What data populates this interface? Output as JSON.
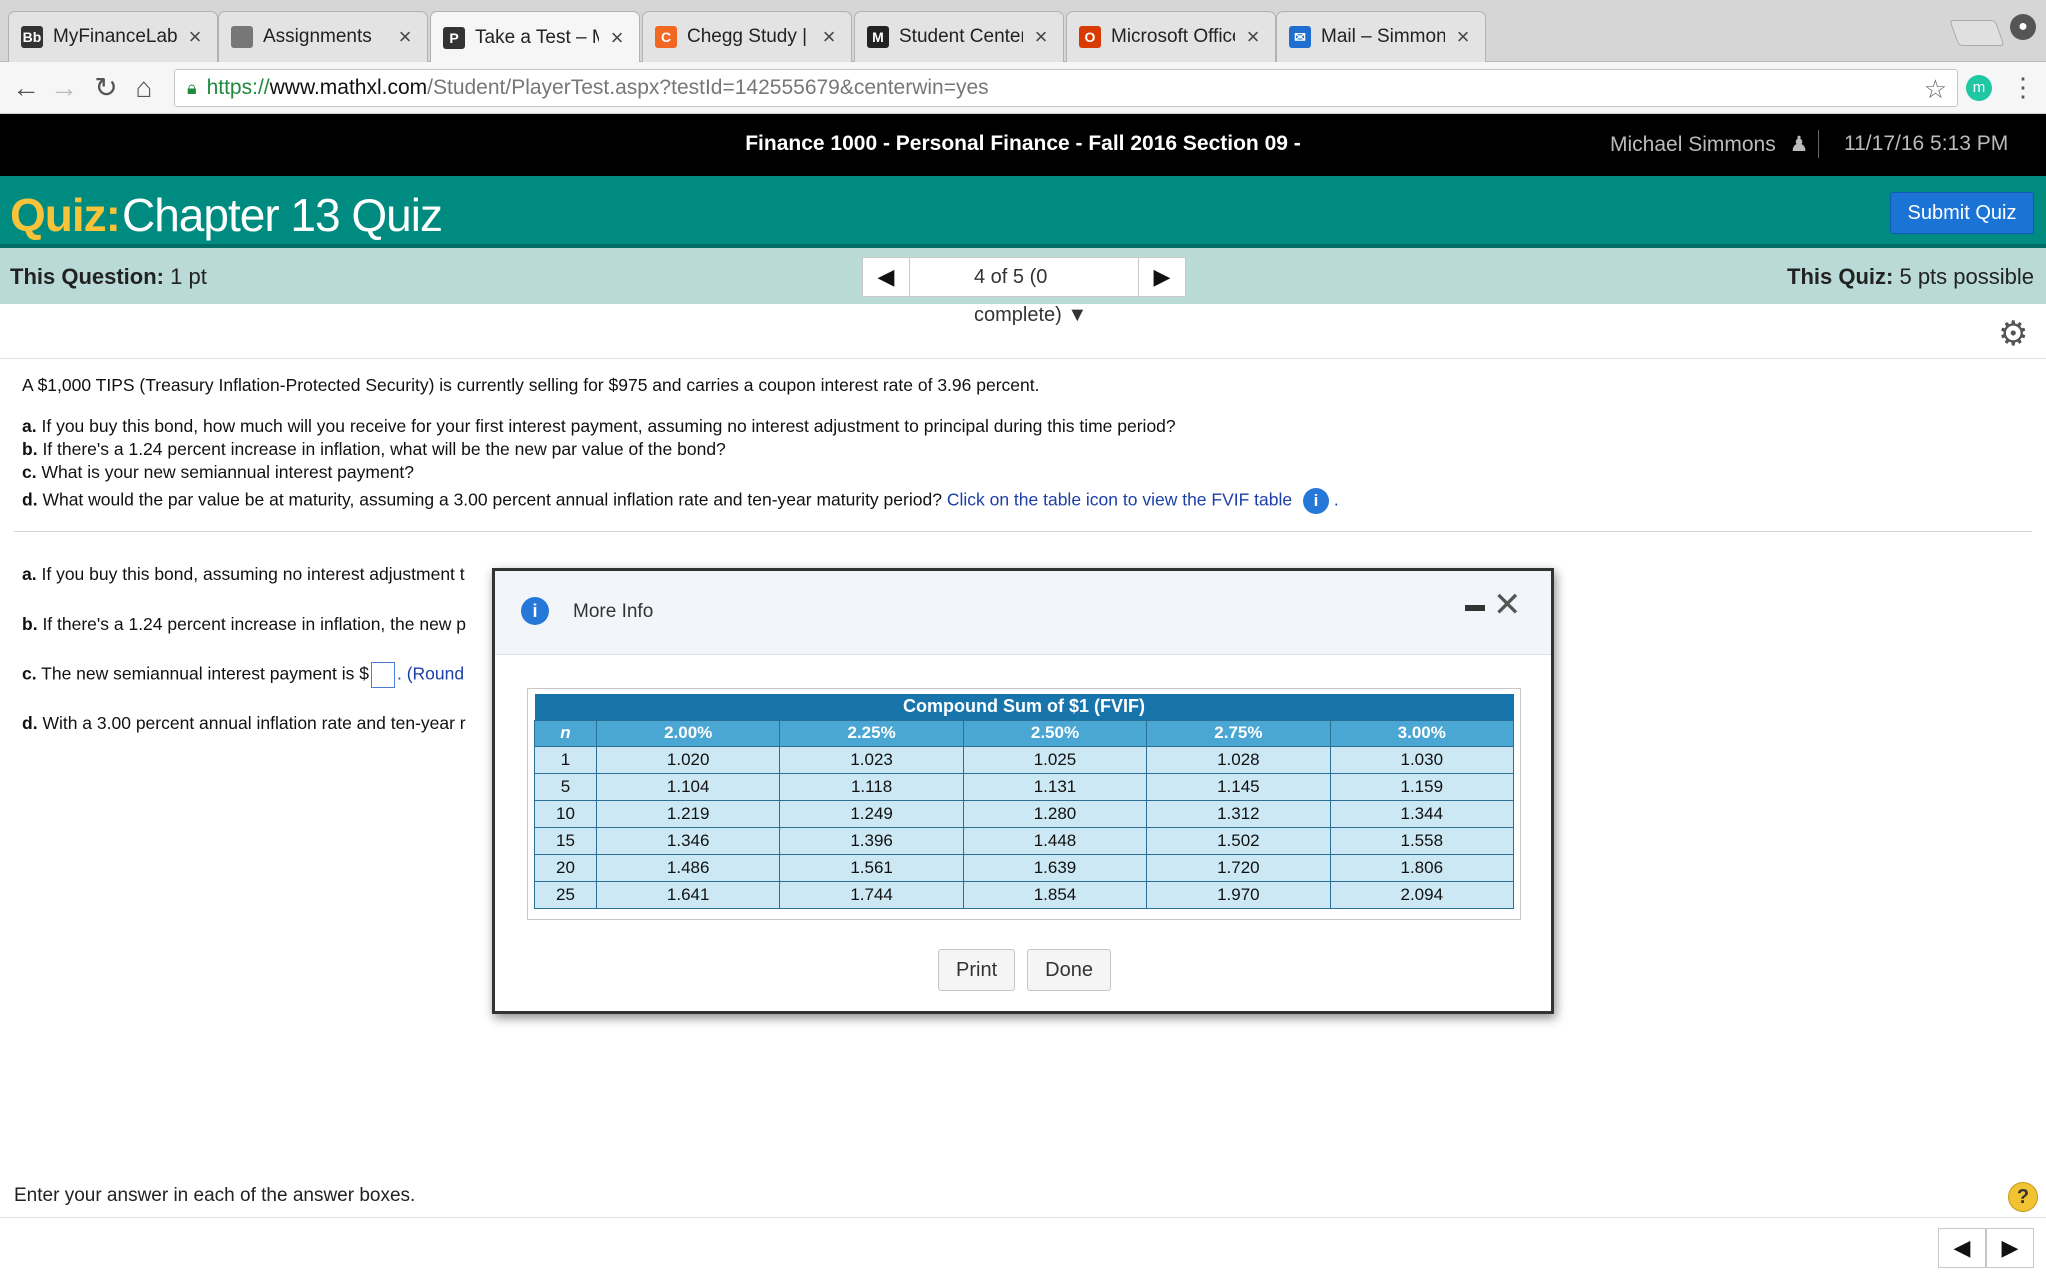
{
  "browser": {
    "tabs": [
      {
        "label": "MyFinanceLab – FINANC",
        "icon": "blackboard-icon",
        "favicon_text": "Bb",
        "favicon_color": "#333333"
      },
      {
        "label": "Assignments",
        "icon": "document-icon",
        "favicon_text": "",
        "favicon_color": "#777777"
      },
      {
        "label": "Take a Test – Michael Si",
        "icon": "pearson-icon",
        "favicon_text": "P",
        "favicon_color": "#333333"
      },
      {
        "label": "Chegg Study | Guided S",
        "icon": "chegg-icon",
        "favicon_text": "C",
        "favicon_color": "#f26722"
      },
      {
        "label": "Student Center",
        "icon": "mizzou-icon",
        "favicon_text": "M",
        "favicon_color": "#222222"
      },
      {
        "label": "Microsoft Office Home",
        "icon": "office-icon",
        "favicon_text": "O",
        "favicon_color": "#d83b01"
      },
      {
        "label": "Mail – Simmons, Michae",
        "icon": "mail-icon",
        "favicon_text": "✉",
        "favicon_color": "#1f6fd0"
      }
    ],
    "url_scheme": "https://",
    "url_host": "www.mathxl.com",
    "url_path": "/Student/PlayerTest.aspx?testId=142555679&centerwin=yes",
    "extension_letter": "m"
  },
  "header": {
    "course_title": "Finance 1000 - Personal Finance - Fall 2016 Section 09 -",
    "user_name": "Michael Simmons",
    "datetime": "11/17/16 5:13 PM"
  },
  "quiz": {
    "prefix": "Quiz:",
    "name": "Chapter 13 Quiz",
    "submit_label": "Submit Quiz",
    "this_question_label": "This Question:",
    "this_question_value": "1 pt",
    "this_quiz_label": "This Quiz:",
    "this_quiz_value": "5 pts possible",
    "pager_text": "4 of 5 (0 complete)"
  },
  "question": {
    "intro": "A $1,000 TIPS (Treasury Inflation-Protected Security) is currently selling for $975 and carries a coupon interest rate of 3.96 percent.",
    "a_label": "a.",
    "a_text": "If you buy this bond, how much will you receive for your first interest payment, assuming no interest adjustment to principal during this time period?",
    "b_label": "b.",
    "b_text": "If there's a 1.24 percent increase in inflation, what will be the new par value of the bond?",
    "c_label": "c.",
    "c_text": "What is your new semiannual interest payment?",
    "d_label": "d.",
    "d_text": "What would the par value be at maturity, assuming a 3.00 percent annual inflation rate and ten-year maturity period?",
    "d_link": "Click on the table icon to view the FVIF table",
    "d_link_end": "."
  },
  "answers": {
    "a_label": "a.",
    "a_text": "If you buy this bond, assuming no interest adjustment t",
    "b_label": "b.",
    "b_text": "If there's a 1.24 percent increase in inflation,  the new p",
    "c_label": "c.",
    "c_text_before": "The new semiannual interest payment is $",
    "c_text_after": ". (Round",
    "d_label": "d.",
    "d_text": "With a 3.00 percent annual inflation rate and ten-year r"
  },
  "footer": {
    "hint": "Enter your answer in each of the answer boxes."
  },
  "modal": {
    "title": "More Info",
    "table_caption": "Compound Sum of $1 (FVIF)",
    "columns": [
      "n",
      "2.00%",
      "2.25%",
      "2.50%",
      "2.75%",
      "3.00%"
    ],
    "rows": [
      [
        "1",
        "1.020",
        "1.023",
        "1.025",
        "1.028",
        "1.030"
      ],
      [
        "5",
        "1.104",
        "1.118",
        "1.131",
        "1.145",
        "1.159"
      ],
      [
        "10",
        "1.219",
        "1.249",
        "1.280",
        "1.312",
        "1.344"
      ],
      [
        "15",
        "1.346",
        "1.396",
        "1.448",
        "1.502",
        "1.558"
      ],
      [
        "20",
        "1.486",
        "1.561",
        "1.639",
        "1.720",
        "1.806"
      ],
      [
        "25",
        "1.641",
        "1.744",
        "1.854",
        "1.970",
        "2.094"
      ]
    ],
    "print_label": "Print",
    "done_label": "Done"
  },
  "colors": {
    "quiz_bar": "#008b80",
    "quiz_prefix": "#f6c33a",
    "submit_button": "#1b73d6",
    "question_bar": "#b9dad7",
    "table_header": "#1775ab",
    "table_cell": "#cce8f4"
  }
}
